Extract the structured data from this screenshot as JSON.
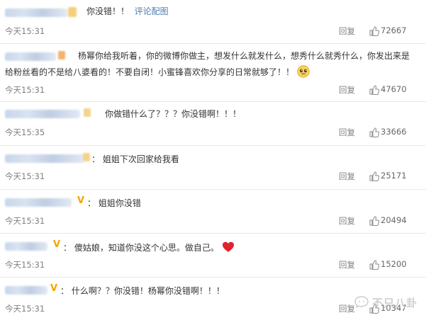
{
  "actions": {
    "reply_label": "回复",
    "thumb_icon": "thumbs-up-icon"
  },
  "comments": [
    {
      "text_before": "你没错！！",
      "link": "评论配图",
      "time": "今天15:31",
      "likes": "72667"
    },
    {
      "line1": "杨幂你给我听着，你的微博你做主，想发什么就发什么，想秀什么就秀什么，你发出来是",
      "line2": "给粉丝看的不是给八婆看的！不要自闭！小蜜锋喜欢你分享的日常就够了！！",
      "emoji": "pleading-face-emoji",
      "time": "今天15:31",
      "likes": "47670"
    },
    {
      "text": "你做错什么了？？？你没错啊！！！",
      "time": "今天15:35",
      "likes": "33666"
    },
    {
      "text": "姐姐下次回家给我看",
      "time": "今天15:31",
      "likes": "25171"
    },
    {
      "text": "姐姐你没错",
      "time": "今天15:31",
      "likes": "20494"
    },
    {
      "text": "傻姑娘，知道你没这个心思。做自己。",
      "emoji": "red-heart-emoji",
      "time": "今天15:31",
      "likes": "15200"
    },
    {
      "text": "什么啊？？你没错！杨幂你没错啊！！！",
      "time": "今天15:31",
      "likes": "10347"
    }
  ],
  "watermark": {
    "text": "不只八卦"
  },
  "colors": {
    "link": "#507daf",
    "meta": "#808080",
    "vip": "#f5a300",
    "heart": "#e0242d"
  }
}
